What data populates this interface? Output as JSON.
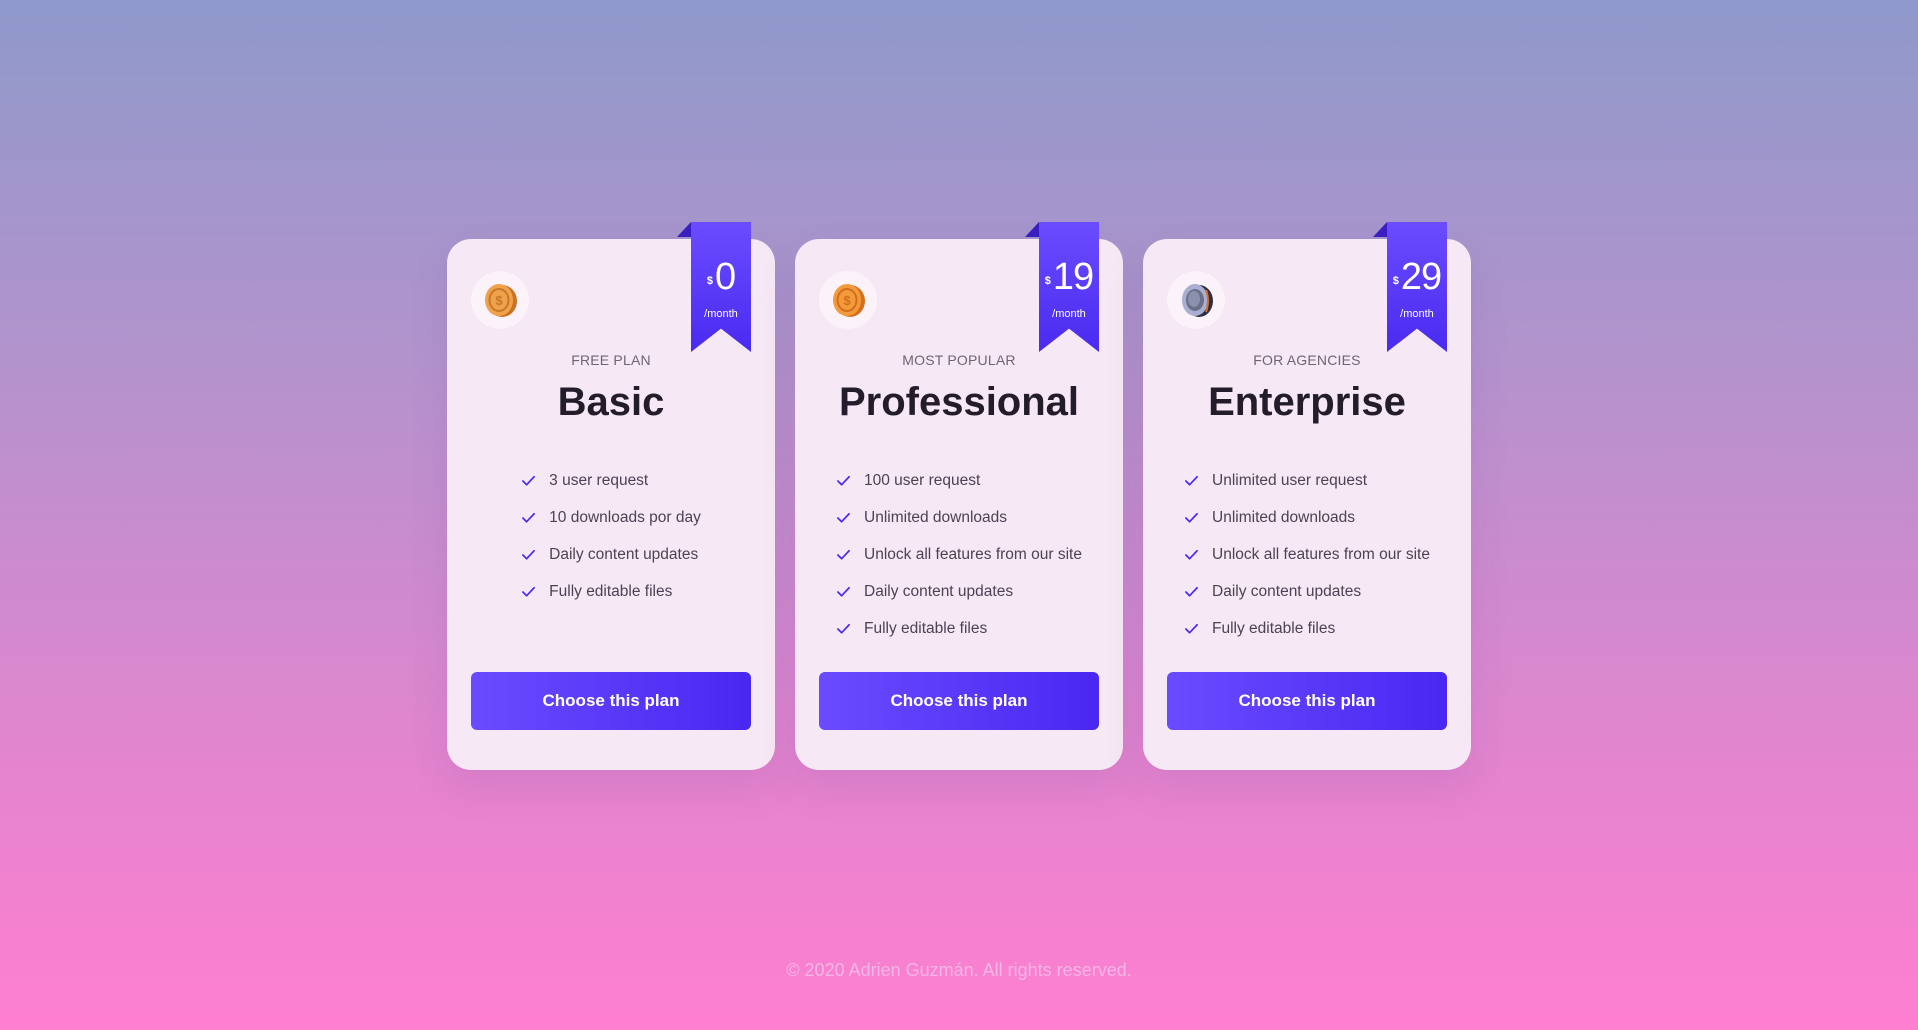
{
  "plans": [
    {
      "tag": "FREE PLAN",
      "name": "Basic",
      "currency": "$",
      "price": "0",
      "period": "/month",
      "icon": "gold-coin-icon",
      "features": [
        "3 user request",
        "10 downloads por day",
        "Daily content updates",
        "Fully editable files"
      ],
      "cta": "Choose this plan"
    },
    {
      "tag": "MOST POPULAR",
      "name": "Professional",
      "currency": "$",
      "price": "19",
      "period": "/month",
      "icon": "gold-coin-icon",
      "features": [
        "100 user request",
        "Unlimited downloads",
        "Unlock all features from our site",
        "Daily content updates",
        "Fully editable files"
      ],
      "cta": "Choose this plan"
    },
    {
      "tag": "FOR AGENCIES",
      "name": "Enterprise",
      "currency": "$",
      "price": "29",
      "period": "/month",
      "icon": "silver-coin-icon",
      "features": [
        "Unlimited user request",
        "Unlimited downloads",
        "Unlock all features from our site",
        "Daily content updates",
        "Fully editable files"
      ],
      "cta": "Choose this plan"
    }
  ],
  "footer": {
    "text": "© 2020 Adrien Guzmán. All rights reserved."
  },
  "colors": {
    "accent": "#5533f5",
    "card": "#f7e8f5",
    "gold": "#e89a3c",
    "silver": "#6b6f86"
  }
}
